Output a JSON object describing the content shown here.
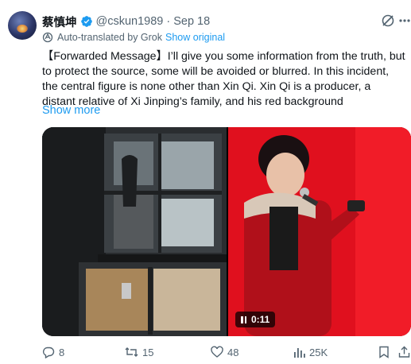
{
  "tweet": {
    "display_name": "蔡慎坤",
    "handle": "@cskun1989",
    "separator": "·",
    "date": "Sep 18",
    "translated_label": "Auto-translated by Grok",
    "show_original": "Show original",
    "text": "【Forwarded Message】I’ll give you some information from the truth, but to protect the source, some will be avoided or blurred. In this incident, the central figure is none other than Xin Qi. Xin Qi is a producer, a distant relative of Xi Jinping’s family, and his red background",
    "show_more": "Show more",
    "video_duration": "0:11"
  },
  "actions": {
    "replies": "8",
    "reposts": "15",
    "likes": "48",
    "views": "25K"
  },
  "colors": {
    "accent": "#1d9bf0",
    "muted": "#536471",
    "text": "#0f1419"
  },
  "icons": [
    "verified-badge-icon",
    "grok-icon",
    "more-icon",
    "translate-icon",
    "reply-icon",
    "repost-icon",
    "like-icon",
    "views-icon",
    "bookmark-icon",
    "share-icon",
    "pause-icon"
  ]
}
